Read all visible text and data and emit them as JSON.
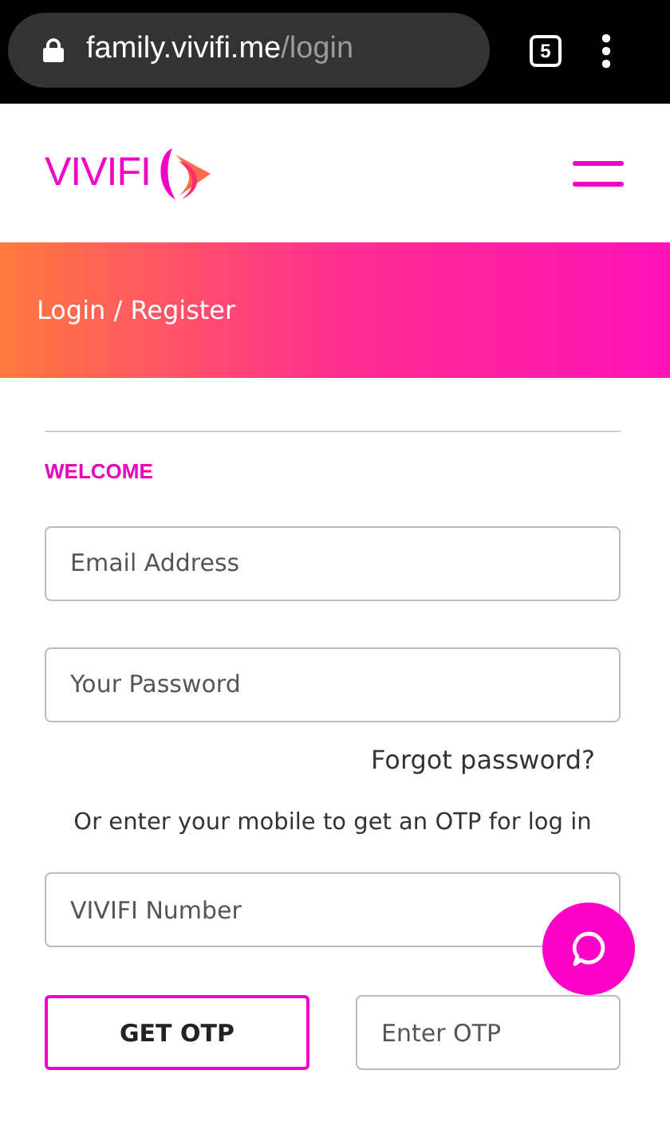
{
  "browser": {
    "url_host": "family.vivifi.me",
    "url_path": "/login",
    "tab_count": "5"
  },
  "header": {
    "logo_text": "VIVIFI"
  },
  "banner": {
    "title": "Login / Register"
  },
  "form": {
    "heading": "WELCOME",
    "fields": [
      {
        "placeholder": "Email Address"
      },
      {
        "placeholder": "Your Password"
      }
    ],
    "forgot_link": "Forgot password?",
    "otp_hint": "Or enter your mobile to get an OTP for log in",
    "mobile_field": {
      "placeholder": "VIVIFI Number"
    },
    "otp_button": "GET OTP",
    "otp_field": {
      "placeholder": "Enter OTP"
    }
  }
}
